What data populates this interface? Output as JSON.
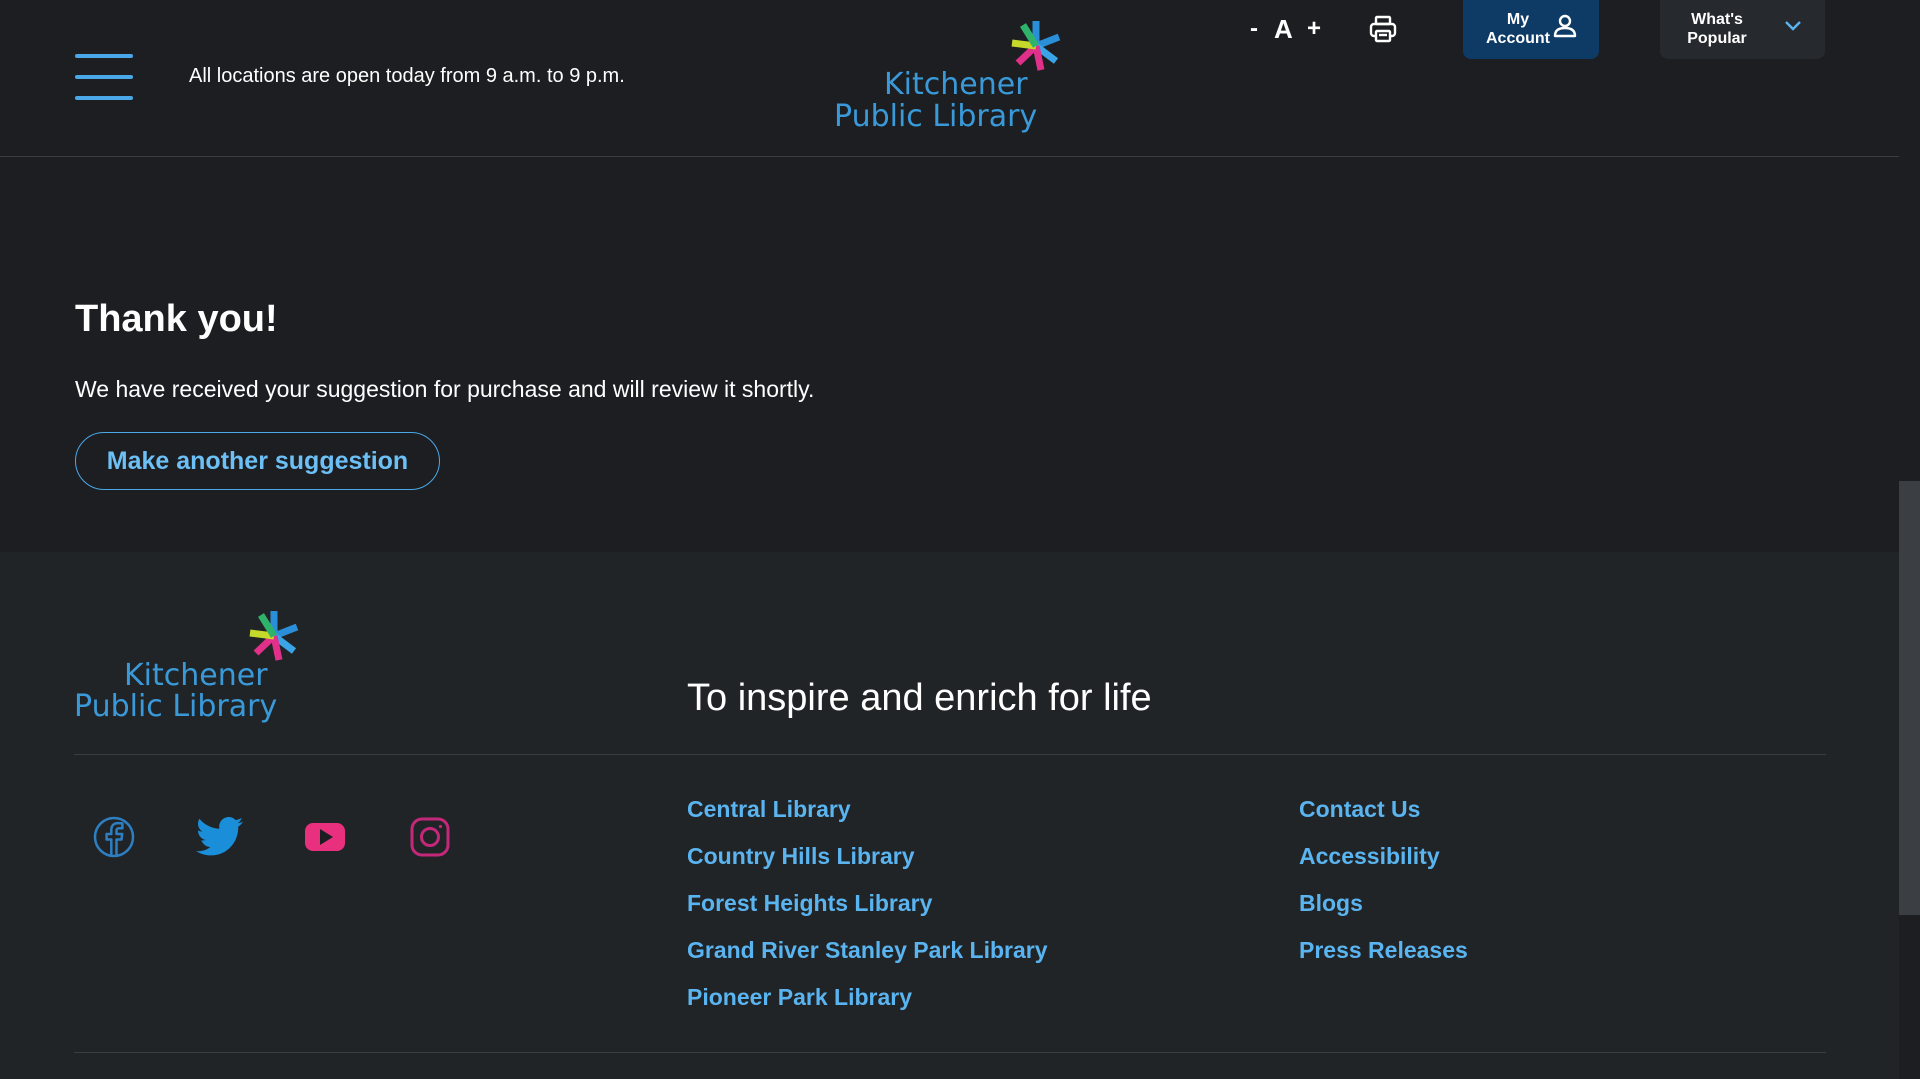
{
  "header": {
    "hours_text": "All locations are open today from 9 a.m. to 9 p.m.",
    "logo": {
      "line1": "Kitchener",
      "line2": "Public Library"
    },
    "font_controls": {
      "decrease": "-",
      "letter": "A",
      "increase": "+"
    },
    "account": {
      "line1": "My",
      "line2": "Account"
    },
    "popular": {
      "line1": "What's",
      "line2": "Popular"
    }
  },
  "main": {
    "title": "Thank you!",
    "message": "We have received your suggestion for purchase and will review it shortly.",
    "button_label": "Make another suggestion"
  },
  "footer": {
    "logo": {
      "line1": "Kitchener",
      "line2": "Public Library"
    },
    "tagline": "To inspire and enrich for life",
    "social_icons": [
      "facebook-icon",
      "twitter-icon",
      "youtube-icon",
      "instagram-icon"
    ],
    "locations": [
      "Central Library",
      "Country Hills Library",
      "Forest Heights Library",
      "Grand River Stanley Park Library",
      "Pioneer Park Library"
    ],
    "info_links": [
      "Contact Us",
      "Accessibility",
      "Blogs",
      "Press Releases"
    ]
  },
  "colors": {
    "background": "#1c1e21",
    "footer_background": "#212427",
    "link_blue": "#5ab4f0",
    "logo_blue": "#3a9ad9",
    "account_blue": "#0e3a66",
    "facebook": "#2d7fc1",
    "twitter": "#1da1f2",
    "youtube": "#e8307f",
    "instagram": "#c3287a"
  }
}
